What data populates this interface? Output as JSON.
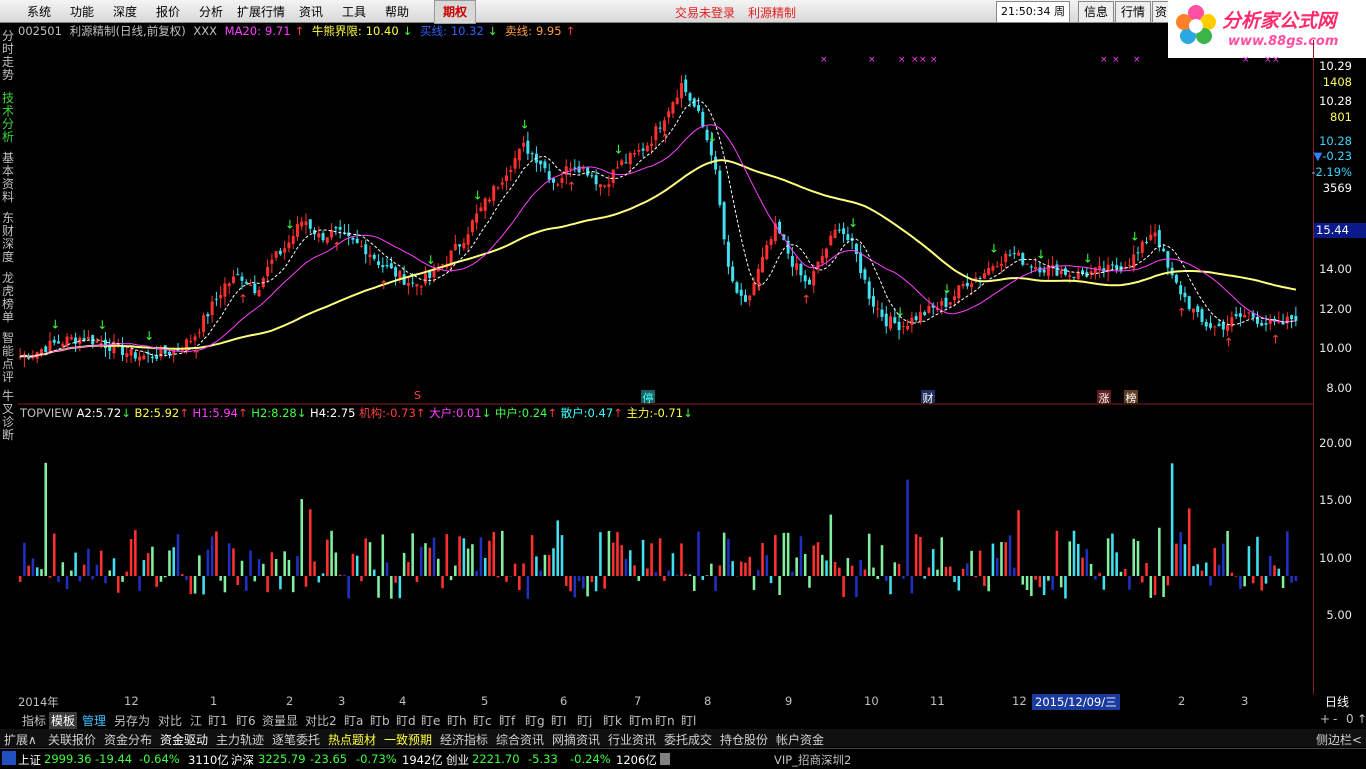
{
  "menubar": {
    "items": [
      "系统",
      "功能",
      "深度",
      "报价",
      "分析",
      "扩展行情",
      "资讯",
      "工具",
      "帮助"
    ],
    "active": "期权",
    "notice_login": "交易未登录",
    "notice_stock": "利源精制",
    "clock": "21:50:34",
    "weekday": "周二",
    "buttons": [
      "信息",
      "行情",
      "资"
    ]
  },
  "logo": {
    "title": "分析家公式网",
    "url": "www.88gs.com"
  },
  "left_tabs": [
    "分时走势",
    "技术分析",
    "基本资料",
    "东财深度",
    "龙虎榜单",
    "智能点评",
    "牛叉诊断"
  ],
  "left_active": "技术分析",
  "info": {
    "code": "002501",
    "name": "利源精制(日线,前复权)",
    "extra": "XXX",
    "ma20_label": "MA20:",
    "ma20": "9.71",
    "bull_label": "牛熊界限:",
    "bull": "10.40",
    "buy_label": "买线:",
    "buy": "10.32",
    "sell_label": "卖线:",
    "sell": "9.95"
  },
  "right_axis_upper": [
    "10.29",
    "1408",
    "10.28",
    "801",
    "10.28",
    "-0.23",
    "-2.19%",
    "3569",
    "15.44",
    "14.00",
    "12.00",
    "10.00",
    "8.00"
  ],
  "markers": {
    "s": "S",
    "ting": "停",
    "cai": "财",
    "zhang": "涨",
    "bang": "榜"
  },
  "lower_info": {
    "name": "TOPVIEW",
    "items": [
      {
        "k": "A2:",
        "v": "5.72",
        "d": "down"
      },
      {
        "k": "B2:",
        "v": "5.92",
        "d": "up"
      },
      {
        "k": "H1:",
        "v": "5.94",
        "d": "up"
      },
      {
        "k": "H2:",
        "v": "8.28",
        "d": "down"
      },
      {
        "k": "H4:",
        "v": "2.75",
        "d": ""
      },
      {
        "k": "机构:",
        "v": "-0.73",
        "d": "up"
      },
      {
        "k": "大户:",
        "v": "0.01",
        "d": "down"
      },
      {
        "k": "中户:",
        "v": "0.24",
        "d": "up"
      },
      {
        "k": "散户:",
        "v": "0.47",
        "d": "up"
      },
      {
        "k": "主力:",
        "v": "-0.71",
        "d": "down"
      }
    ]
  },
  "right_axis_lower": [
    "20.00",
    "15.00",
    "10.00",
    "5.00"
  ],
  "time_axis": [
    "2014年",
    "12",
    "1",
    "2",
    "3",
    "4",
    "5",
    "6",
    "7",
    "8",
    "9",
    "10",
    "11",
    "12",
    "3",
    "2",
    "3"
  ],
  "time_cursor": "2015/12/09/三",
  "period_label": "日线",
  "tabs_row1": [
    "指标",
    "模板",
    "管理",
    "另存为",
    "对比",
    "江",
    "盯1",
    "盯6",
    "资量显",
    "对比2",
    "盯a",
    "盯b",
    "盯d",
    "盯e",
    "盯h",
    "盯c",
    "盯f",
    "盯g",
    "盯I",
    "盯j",
    "盯k",
    "盯m",
    "盯n",
    "盯l"
  ],
  "tabs_row1_right": [
    "+",
    "-",
    "0",
    "↑"
  ],
  "tabs_row2": [
    "扩展∧",
    "关联报价",
    "资金分布",
    "资金驱动",
    "主力轨迹",
    "逐笔委托",
    "热点题材",
    "一致预期",
    "经济指标",
    "综合资讯",
    "网摘资讯",
    "行业资讯",
    "委托成交",
    "持仓股份",
    "帐户资金"
  ],
  "tabs_row2_right": "侧边栏<",
  "status": {
    "sh_label": "上证",
    "sh": "2999.36",
    "sh_chg": "-19.44",
    "sh_pct": "-0.64%",
    "sh_vol": "3110亿",
    "hs_label": "沪深",
    "hs": "3225.79",
    "hs_chg": "-23.65",
    "hs_pct": "-0.73%",
    "hs_vol": "1942亿",
    "cy_label": "创业",
    "cy": "2221.70",
    "cy_chg": "-5.33",
    "cy_pct": "-0.24%",
    "cy_vol": "1206亿",
    "server": "VIP_招商深圳2"
  },
  "chart_data": {
    "type": "candlestick",
    "price_axis": {
      "ticks": [
        8,
        10,
        12,
        14
      ],
      "ylim": [
        7.2,
        16.4
      ]
    },
    "close_series": [
      8.6,
      8.8,
      9.1,
      9.3,
      9.4,
      9.2,
      9.0,
      8.7,
      8.6,
      8.7,
      8.9,
      9.4,
      10.5,
      11.6,
      12.0,
      11.4,
      12.6,
      13.3,
      14.4,
      13.6,
      13.8,
      13.4,
      13.1,
      12.4,
      12.0,
      11.6,
      11.9,
      12.6,
      13.4,
      14.5,
      15.5,
      16.5,
      17.4,
      16.8,
      15.8,
      16.7,
      16.4,
      15.7,
      16.6,
      17.0,
      17.6,
      18.8,
      20.0,
      18.8,
      17.0,
      12.0,
      10.6,
      12.4,
      14.0,
      12.6,
      11.5,
      12.9,
      14.1,
      13.0,
      11.0,
      10.1,
      9.9,
      10.3,
      10.6,
      10.9,
      11.7,
      12.0,
      12.6,
      12.9,
      12.5,
      12.3,
      12.2,
      12.0,
      12.1,
      12.2,
      12.4,
      12.9,
      14.0,
      12.0,
      11.0,
      10.0,
      9.8,
      10.1,
      10.4,
      10.0,
      9.9,
      10.3
    ],
    "volume_axis": {
      "ticks": [
        5,
        10,
        15,
        20
      ],
      "ylim": [
        0,
        23
      ]
    }
  }
}
